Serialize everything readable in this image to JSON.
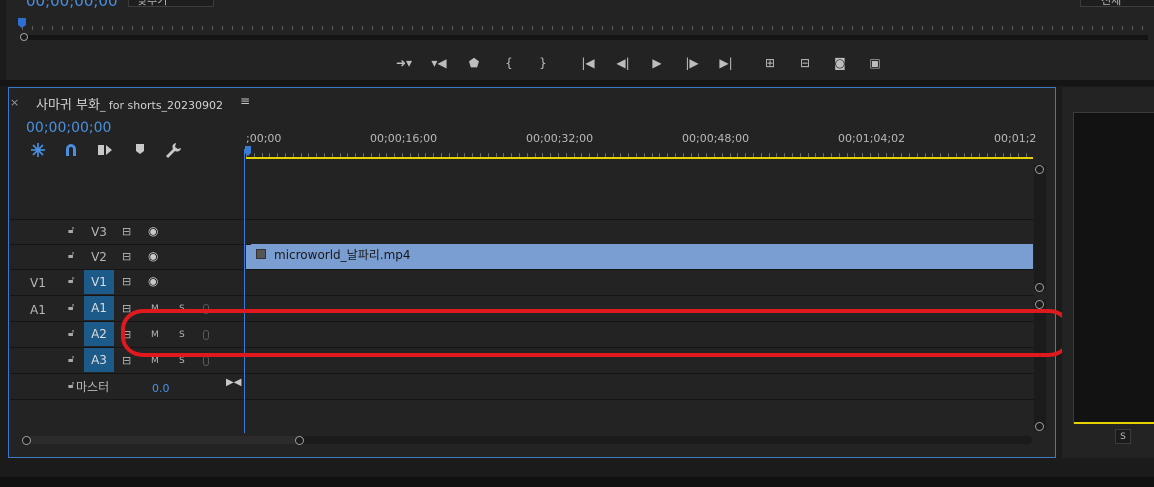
{
  "source": {
    "timecode": "00;00;00;00",
    "fit_label": "맞추기",
    "quality_label": "전체"
  },
  "transport": [
    {
      "name": "mark-in-button",
      "glyph": "➜▾"
    },
    {
      "name": "mark-out-button",
      "glyph": "▾◀"
    },
    {
      "name": "add-marker-button",
      "glyph": "⬟"
    },
    {
      "name": "mark-in-bracket-button",
      "glyph": "{"
    },
    {
      "name": "mark-out-bracket-button",
      "glyph": "}"
    },
    {
      "name": "go-to-in-button",
      "glyph": "|◀"
    },
    {
      "name": "step-back-button",
      "glyph": "◀|"
    },
    {
      "name": "play-button",
      "glyph": "▶"
    },
    {
      "name": "step-forward-button",
      "glyph": "|▶"
    },
    {
      "name": "go-to-out-button",
      "glyph": "▶|"
    },
    {
      "name": "lift-button",
      "glyph": "⊞"
    },
    {
      "name": "extract-button",
      "glyph": "⊟"
    },
    {
      "name": "export-frame-button",
      "glyph": "◙"
    },
    {
      "name": "compare-button",
      "glyph": "▣"
    }
  ],
  "timeline": {
    "close": "×",
    "title": "사마귀 부화",
    "title_suffix": "_ for shorts_20230902",
    "menu": "≡",
    "timecode": "00;00;00;00",
    "ruler_labels": [
      ";00;00",
      "00;00;16;00",
      "00;00;32;00",
      "00;00;48;00",
      "00;01;04;02",
      "00;01;2"
    ],
    "tracks": {
      "v3": {
        "name": "V3"
      },
      "v2": {
        "name": "V2"
      },
      "v1": {
        "source": "V1",
        "name": "V1"
      },
      "a1": {
        "source": "A1",
        "name": "A1",
        "m": "M",
        "s": "S"
      },
      "a2": {
        "name": "A2",
        "m": "M",
        "s": "S"
      },
      "a3": {
        "name": "A3",
        "m": "M",
        "s": "S"
      },
      "master": {
        "name": "마스터",
        "value": "0.0"
      }
    },
    "clip": {
      "name": "microworld_날파리.mp4"
    }
  },
  "right_panel": {
    "s_label": "S"
  },
  "colors": {
    "accent": "#4a90e2",
    "clip": "#7a9ed1",
    "annotation": "#e0191f",
    "work_area": "#e6d200"
  }
}
